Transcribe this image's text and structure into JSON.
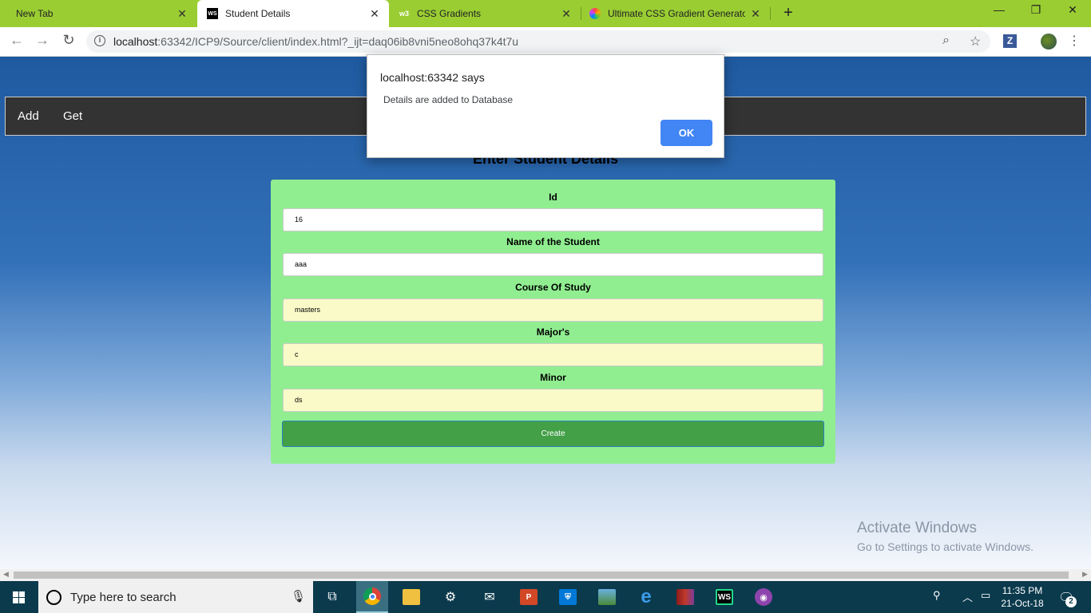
{
  "browser": {
    "tabs": [
      {
        "label": "New Tab",
        "icon": "blank"
      },
      {
        "label": "Student Details",
        "icon": "webstorm-icon"
      },
      {
        "label": "CSS Gradients",
        "icon": "w3schools-icon"
      },
      {
        "label": "Ultimate CSS Gradient Generator",
        "icon": "gradient-icon"
      }
    ],
    "new_tab_symbol": "+",
    "window_controls": {
      "minimize": "—",
      "restore": "❐",
      "close": "✕"
    },
    "url_host": "localhost",
    "url_rest": ":63342/ICP9/Source/client/index.html?_ijt=daq06ib8vni5neo8ohq37k4t7u",
    "extension_label": "Z"
  },
  "page": {
    "nav": {
      "add": "Add",
      "get": "Get"
    },
    "heading": "Enter Student Details",
    "form": {
      "id_label": "Id",
      "id_value": "16",
      "name_label": "Name of the Student",
      "name_value": "aaa",
      "course_label": "Course Of Study",
      "course_value": "masters",
      "major_label": "Major's",
      "major_value": "c",
      "minor_label": "Minor",
      "minor_value": "ds",
      "create_label": "Create"
    },
    "watermark": {
      "line1": "Activate Windows",
      "line2": "Go to Settings to activate Windows."
    }
  },
  "dialog": {
    "title": "localhost:63342 says",
    "message": "Details are added to Database",
    "ok_label": "OK"
  },
  "taskbar": {
    "search_placeholder": "Type here to search",
    "time": "11:35 PM",
    "date": "21-Oct-18",
    "notification_count": "2"
  },
  "colors": {
    "tabstrip": "#9acd32",
    "navbar": "#333333",
    "form_bg": "#90ee90",
    "create_btn": "#43a047",
    "ok_btn": "#4285f4"
  }
}
